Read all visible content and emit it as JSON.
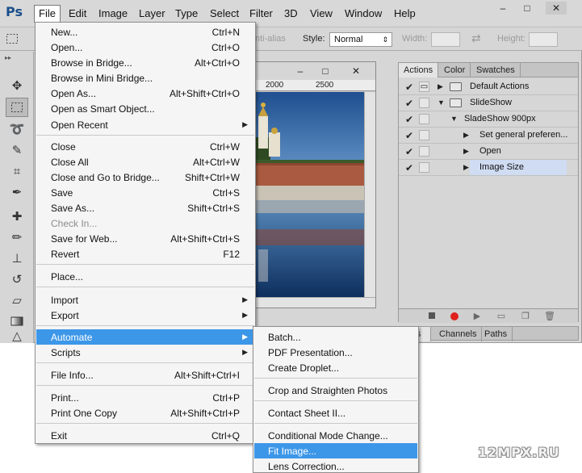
{
  "app": {
    "logo": "Ps"
  },
  "menubar": {
    "items": [
      "File",
      "Edit",
      "Image",
      "Layer",
      "Type",
      "Select",
      "Filter",
      "3D",
      "View",
      "Window",
      "Help"
    ],
    "window_buttons": [
      "–",
      "□",
      "✕"
    ]
  },
  "options": {
    "antialias_label": "nti-alias",
    "style_label": "Style:",
    "style_value": "Normal",
    "width_label": "Width:",
    "height_label": "Height:"
  },
  "document": {
    "ruler_ticks": [
      "2000",
      "2500"
    ],
    "window_buttons": [
      "–",
      "□",
      "✕"
    ]
  },
  "actions_panel": {
    "tabs": [
      "Actions",
      "Color",
      "Swatches"
    ],
    "rows": [
      {
        "check": "✔",
        "dialog": "▭",
        "expand": "▶",
        "folder": true,
        "label": "Default Actions"
      },
      {
        "check": "✔",
        "dialog": "",
        "expand": "▼",
        "folder": true,
        "label": "SlideShow"
      },
      {
        "check": "✔",
        "dialog": "",
        "expand": "▼",
        "folder": false,
        "label": "SladeShow 900px"
      },
      {
        "check": "✔",
        "dialog": "",
        "expand": "▶",
        "folder": false,
        "label": "Set general preferen..."
      },
      {
        "check": "✔",
        "dialog": "",
        "expand": "▶",
        "folder": false,
        "label": "Open"
      },
      {
        "check": "✔",
        "dialog": "",
        "expand": "▶",
        "folder": false,
        "label": "Image Size",
        "selected": true
      }
    ],
    "bottom_icons": [
      "stop-icon",
      "record-icon",
      "play-icon",
      "folder-icon",
      "new-icon",
      "trash-icon"
    ]
  },
  "layers_panel": {
    "tabs": [
      "ers",
      "Channels",
      "Paths"
    ]
  },
  "file_menu": {
    "items": [
      {
        "label": "New...",
        "shortcut": "Ctrl+N"
      },
      {
        "label": "Open...",
        "shortcut": "Ctrl+O"
      },
      {
        "label": "Browse in Bridge...",
        "shortcut": "Alt+Ctrl+O"
      },
      {
        "label": "Browse in Mini Bridge...",
        "shortcut": ""
      },
      {
        "label": "Open As...",
        "shortcut": "Alt+Shift+Ctrl+O"
      },
      {
        "label": "Open as Smart Object...",
        "shortcut": ""
      },
      {
        "label": "Open Recent",
        "shortcut": "",
        "submenu": true
      },
      {
        "label": "Close",
        "shortcut": "Ctrl+W"
      },
      {
        "label": "Close All",
        "shortcut": "Alt+Ctrl+W"
      },
      {
        "label": "Close and Go to Bridge...",
        "shortcut": "Shift+Ctrl+W"
      },
      {
        "label": "Save",
        "shortcut": "Ctrl+S"
      },
      {
        "label": "Save As...",
        "shortcut": "Shift+Ctrl+S"
      },
      {
        "label": "Check In...",
        "shortcut": "",
        "disabled": true
      },
      {
        "label": "Save for Web...",
        "shortcut": "Alt+Shift+Ctrl+S"
      },
      {
        "label": "Revert",
        "shortcut": "F12"
      },
      {
        "label": "Place...",
        "shortcut": ""
      },
      {
        "label": "Import",
        "shortcut": "",
        "submenu": true
      },
      {
        "label": "Export",
        "shortcut": "",
        "submenu": true
      },
      {
        "label": "Automate",
        "shortcut": "",
        "submenu": true,
        "highlighted": true
      },
      {
        "label": "Scripts",
        "shortcut": "",
        "submenu": true
      },
      {
        "label": "File Info...",
        "shortcut": "Alt+Shift+Ctrl+I"
      },
      {
        "label": "Print...",
        "shortcut": "Ctrl+P"
      },
      {
        "label": "Print One Copy",
        "shortcut": "Alt+Shift+Ctrl+P"
      },
      {
        "label": "Exit",
        "shortcut": "Ctrl+Q"
      }
    ]
  },
  "automate_menu": {
    "items": [
      {
        "label": "Batch..."
      },
      {
        "label": "PDF Presentation..."
      },
      {
        "label": "Create Droplet..."
      },
      {
        "label": "Crop and Straighten Photos"
      },
      {
        "label": "Contact Sheet II..."
      },
      {
        "label": "Conditional Mode Change..."
      },
      {
        "label": "Fit Image...",
        "highlighted": true
      },
      {
        "label": "Lens Correction..."
      }
    ]
  },
  "watermark": "12MPX.RU",
  "colors": {
    "highlight": "#3d97e8",
    "record": "#e0201c"
  }
}
